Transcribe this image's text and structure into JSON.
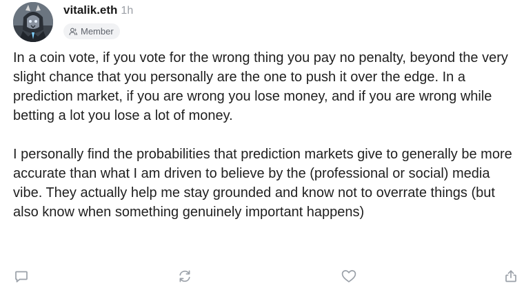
{
  "author": {
    "name": "vitalik.eth",
    "time": "1h",
    "badge": "Member",
    "avatar_icon": "avatar-image"
  },
  "post": {
    "paragraphs": [
      "In a coin vote, if you vote for the wrong thing you pay no penalty, beyond the very slight chance that you personally are the one to push it over the edge. In a prediction market, if you are wrong you lose money, and if you are wrong while betting a lot you lose a lot of money.",
      "I personally find the probabilities that prediction markets give to generally be more accurate than what I am driven to believe by the (professional or social) media vibe. They actually help me stay grounded and know not to overrate things (but also know when something genuinely important happens)"
    ]
  },
  "actions": [
    {
      "name": "reply",
      "icon": "comment-icon"
    },
    {
      "name": "recast",
      "icon": "repost-icon"
    },
    {
      "name": "like",
      "icon": "heart-icon"
    },
    {
      "name": "share",
      "icon": "share-icon"
    }
  ],
  "colors": {
    "text": "#1f1f1f",
    "muted": "#9a9ea5",
    "icon": "#9aa0a8",
    "badge_bg": "#f1f2f4"
  }
}
